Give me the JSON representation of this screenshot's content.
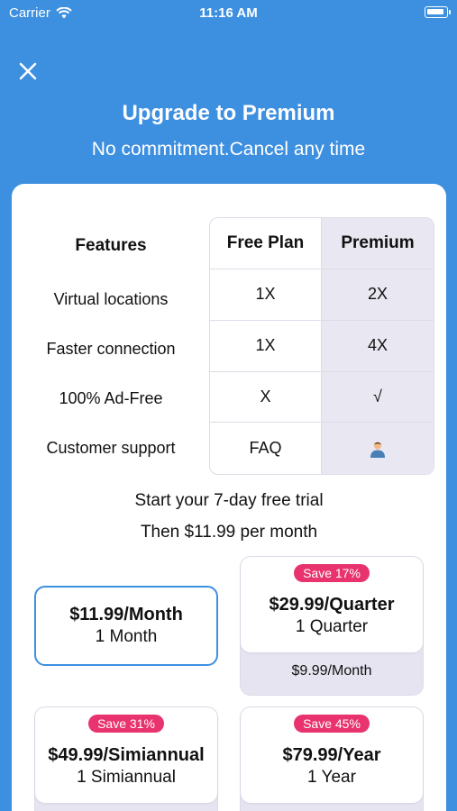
{
  "status_bar": {
    "carrier": "Carrier",
    "time": "11:16 AM"
  },
  "header": {
    "title": "Upgrade to Premium",
    "subtitle": "No commitment.Cancel any time"
  },
  "features": {
    "heading": "Features",
    "rows": [
      "Virtual locations",
      "Faster connection",
      "100% Ad-Free",
      "Customer support"
    ]
  },
  "plans_table": {
    "free_heading": "Free Plan",
    "premium_heading": "Premium",
    "free": [
      "1X",
      "1X",
      "X",
      "FAQ"
    ],
    "premium": [
      "2X",
      "4X",
      "√",
      ""
    ]
  },
  "trial": {
    "line1": "Start your 7-day free trial",
    "line2": "Then $11.99 per month"
  },
  "plans": {
    "month": {
      "price": "$11.99/Month",
      "period": "1 Month"
    },
    "quarter": {
      "badge": "Save 17%",
      "price": "$29.99/Quarter",
      "period": "1 Quarter",
      "per_month": "$9.99/Month"
    },
    "semi": {
      "badge": "Save 31%",
      "price": "$49.99/Simiannual",
      "period": "1 Simiannual"
    },
    "year": {
      "badge": "Save 45%",
      "price": "$79.99/Year",
      "period": "1 Year"
    }
  },
  "colors": {
    "background": "#3d8fe0",
    "accent": "#3d8fe0",
    "badge": "#e8336e",
    "premium_column": "#e9e8f2"
  },
  "icons": {
    "close": "close-icon",
    "wifi": "wifi-icon",
    "battery": "battery-icon",
    "support": "person-icon"
  }
}
